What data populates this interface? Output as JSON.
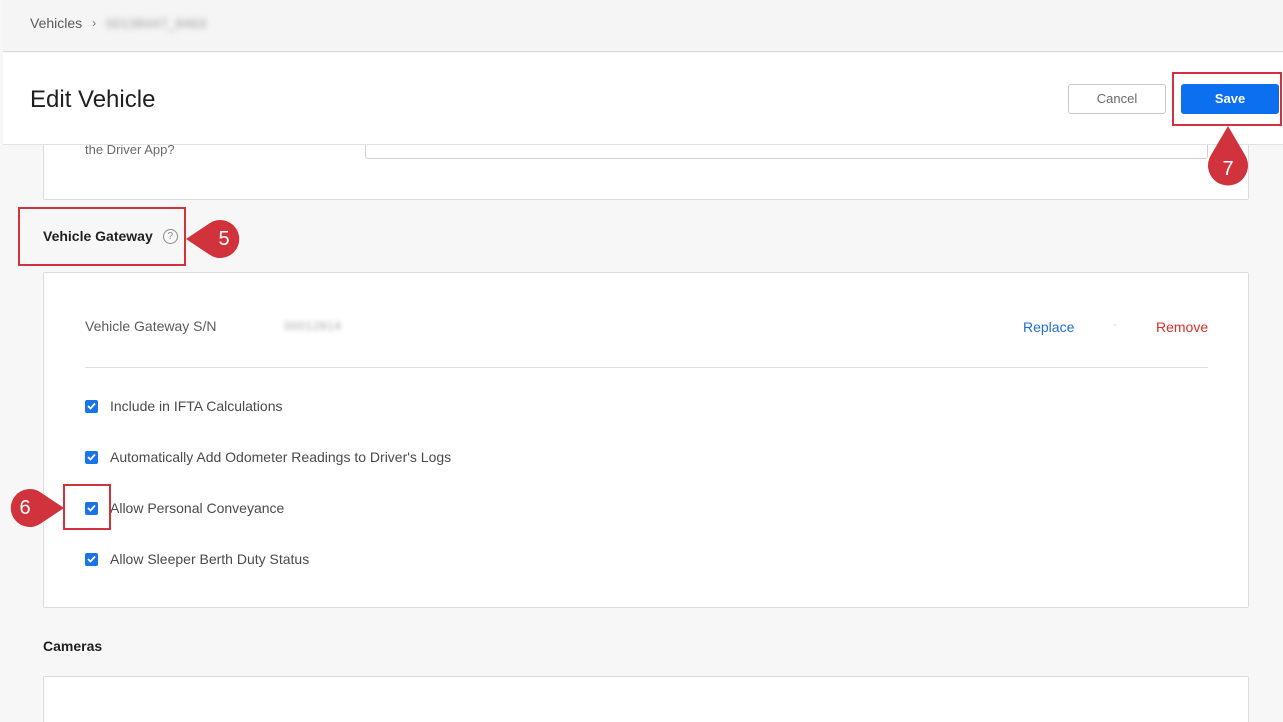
{
  "breadcrumb": {
    "root": "Vehicles",
    "separator": "›",
    "current": "00138447_8463"
  },
  "header": {
    "title": "Edit Vehicle",
    "cancel_label": "Cancel",
    "save_label": "Save"
  },
  "top_card": {
    "partial_label": "the Driver App?"
  },
  "gateway_section": {
    "heading": "Vehicle Gateway",
    "help_icon": "question-circle-icon",
    "serial_label": "Vehicle Gateway S/N",
    "serial_value": "00012814",
    "replace_label": "Replace",
    "separator": "·",
    "remove_label": "Remove",
    "options": [
      {
        "label": "Include in IFTA Calculations",
        "checked": true
      },
      {
        "label": "Automatically Add Odometer Readings to Driver's Logs",
        "checked": true
      },
      {
        "label": "Allow Personal Conveyance",
        "checked": true
      },
      {
        "label": "Allow Sleeper Berth Duty Status",
        "checked": true
      }
    ]
  },
  "cameras_section": {
    "heading": "Cameras"
  },
  "annotations": [
    {
      "number": "5"
    },
    {
      "number": "6"
    },
    {
      "number": "7"
    }
  ],
  "colors": {
    "primary": "#0b6ff0",
    "link": "#1f70d6",
    "danger": "#d93025",
    "annotation": "#d0333b",
    "checkbox": "#1a73e8"
  }
}
